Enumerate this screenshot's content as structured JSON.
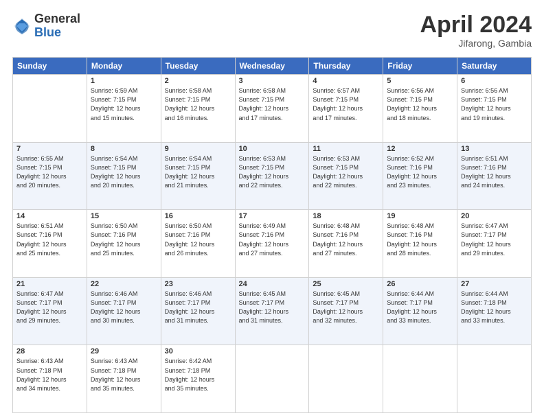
{
  "logo": {
    "general": "General",
    "blue": "Blue"
  },
  "title": {
    "month": "April 2024",
    "location": "Jifarong, Gambia"
  },
  "header_days": [
    "Sunday",
    "Monday",
    "Tuesday",
    "Wednesday",
    "Thursday",
    "Friday",
    "Saturday"
  ],
  "weeks": [
    [
      {
        "day": "",
        "info": ""
      },
      {
        "day": "1",
        "info": "Sunrise: 6:59 AM\nSunset: 7:15 PM\nDaylight: 12 hours\nand 15 minutes."
      },
      {
        "day": "2",
        "info": "Sunrise: 6:58 AM\nSunset: 7:15 PM\nDaylight: 12 hours\nand 16 minutes."
      },
      {
        "day": "3",
        "info": "Sunrise: 6:58 AM\nSunset: 7:15 PM\nDaylight: 12 hours\nand 17 minutes."
      },
      {
        "day": "4",
        "info": "Sunrise: 6:57 AM\nSunset: 7:15 PM\nDaylight: 12 hours\nand 17 minutes."
      },
      {
        "day": "5",
        "info": "Sunrise: 6:56 AM\nSunset: 7:15 PM\nDaylight: 12 hours\nand 18 minutes."
      },
      {
        "day": "6",
        "info": "Sunrise: 6:56 AM\nSunset: 7:15 PM\nDaylight: 12 hours\nand 19 minutes."
      }
    ],
    [
      {
        "day": "7",
        "info": "Sunrise: 6:55 AM\nSunset: 7:15 PM\nDaylight: 12 hours\nand 20 minutes."
      },
      {
        "day": "8",
        "info": "Sunrise: 6:54 AM\nSunset: 7:15 PM\nDaylight: 12 hours\nand 20 minutes."
      },
      {
        "day": "9",
        "info": "Sunrise: 6:54 AM\nSunset: 7:15 PM\nDaylight: 12 hours\nand 21 minutes."
      },
      {
        "day": "10",
        "info": "Sunrise: 6:53 AM\nSunset: 7:15 PM\nDaylight: 12 hours\nand 22 minutes."
      },
      {
        "day": "11",
        "info": "Sunrise: 6:53 AM\nSunset: 7:15 PM\nDaylight: 12 hours\nand 22 minutes."
      },
      {
        "day": "12",
        "info": "Sunrise: 6:52 AM\nSunset: 7:16 PM\nDaylight: 12 hours\nand 23 minutes."
      },
      {
        "day": "13",
        "info": "Sunrise: 6:51 AM\nSunset: 7:16 PM\nDaylight: 12 hours\nand 24 minutes."
      }
    ],
    [
      {
        "day": "14",
        "info": "Sunrise: 6:51 AM\nSunset: 7:16 PM\nDaylight: 12 hours\nand 25 minutes."
      },
      {
        "day": "15",
        "info": "Sunrise: 6:50 AM\nSunset: 7:16 PM\nDaylight: 12 hours\nand 25 minutes."
      },
      {
        "day": "16",
        "info": "Sunrise: 6:50 AM\nSunset: 7:16 PM\nDaylight: 12 hours\nand 26 minutes."
      },
      {
        "day": "17",
        "info": "Sunrise: 6:49 AM\nSunset: 7:16 PM\nDaylight: 12 hours\nand 27 minutes."
      },
      {
        "day": "18",
        "info": "Sunrise: 6:48 AM\nSunset: 7:16 PM\nDaylight: 12 hours\nand 27 minutes."
      },
      {
        "day": "19",
        "info": "Sunrise: 6:48 AM\nSunset: 7:16 PM\nDaylight: 12 hours\nand 28 minutes."
      },
      {
        "day": "20",
        "info": "Sunrise: 6:47 AM\nSunset: 7:17 PM\nDaylight: 12 hours\nand 29 minutes."
      }
    ],
    [
      {
        "day": "21",
        "info": "Sunrise: 6:47 AM\nSunset: 7:17 PM\nDaylight: 12 hours\nand 29 minutes."
      },
      {
        "day": "22",
        "info": "Sunrise: 6:46 AM\nSunset: 7:17 PM\nDaylight: 12 hours\nand 30 minutes."
      },
      {
        "day": "23",
        "info": "Sunrise: 6:46 AM\nSunset: 7:17 PM\nDaylight: 12 hours\nand 31 minutes."
      },
      {
        "day": "24",
        "info": "Sunrise: 6:45 AM\nSunset: 7:17 PM\nDaylight: 12 hours\nand 31 minutes."
      },
      {
        "day": "25",
        "info": "Sunrise: 6:45 AM\nSunset: 7:17 PM\nDaylight: 12 hours\nand 32 minutes."
      },
      {
        "day": "26",
        "info": "Sunrise: 6:44 AM\nSunset: 7:17 PM\nDaylight: 12 hours\nand 33 minutes."
      },
      {
        "day": "27",
        "info": "Sunrise: 6:44 AM\nSunset: 7:18 PM\nDaylight: 12 hours\nand 33 minutes."
      }
    ],
    [
      {
        "day": "28",
        "info": "Sunrise: 6:43 AM\nSunset: 7:18 PM\nDaylight: 12 hours\nand 34 minutes."
      },
      {
        "day": "29",
        "info": "Sunrise: 6:43 AM\nSunset: 7:18 PM\nDaylight: 12 hours\nand 35 minutes."
      },
      {
        "day": "30",
        "info": "Sunrise: 6:42 AM\nSunset: 7:18 PM\nDaylight: 12 hours\nand 35 minutes."
      },
      {
        "day": "",
        "info": ""
      },
      {
        "day": "",
        "info": ""
      },
      {
        "day": "",
        "info": ""
      },
      {
        "day": "",
        "info": ""
      }
    ]
  ]
}
